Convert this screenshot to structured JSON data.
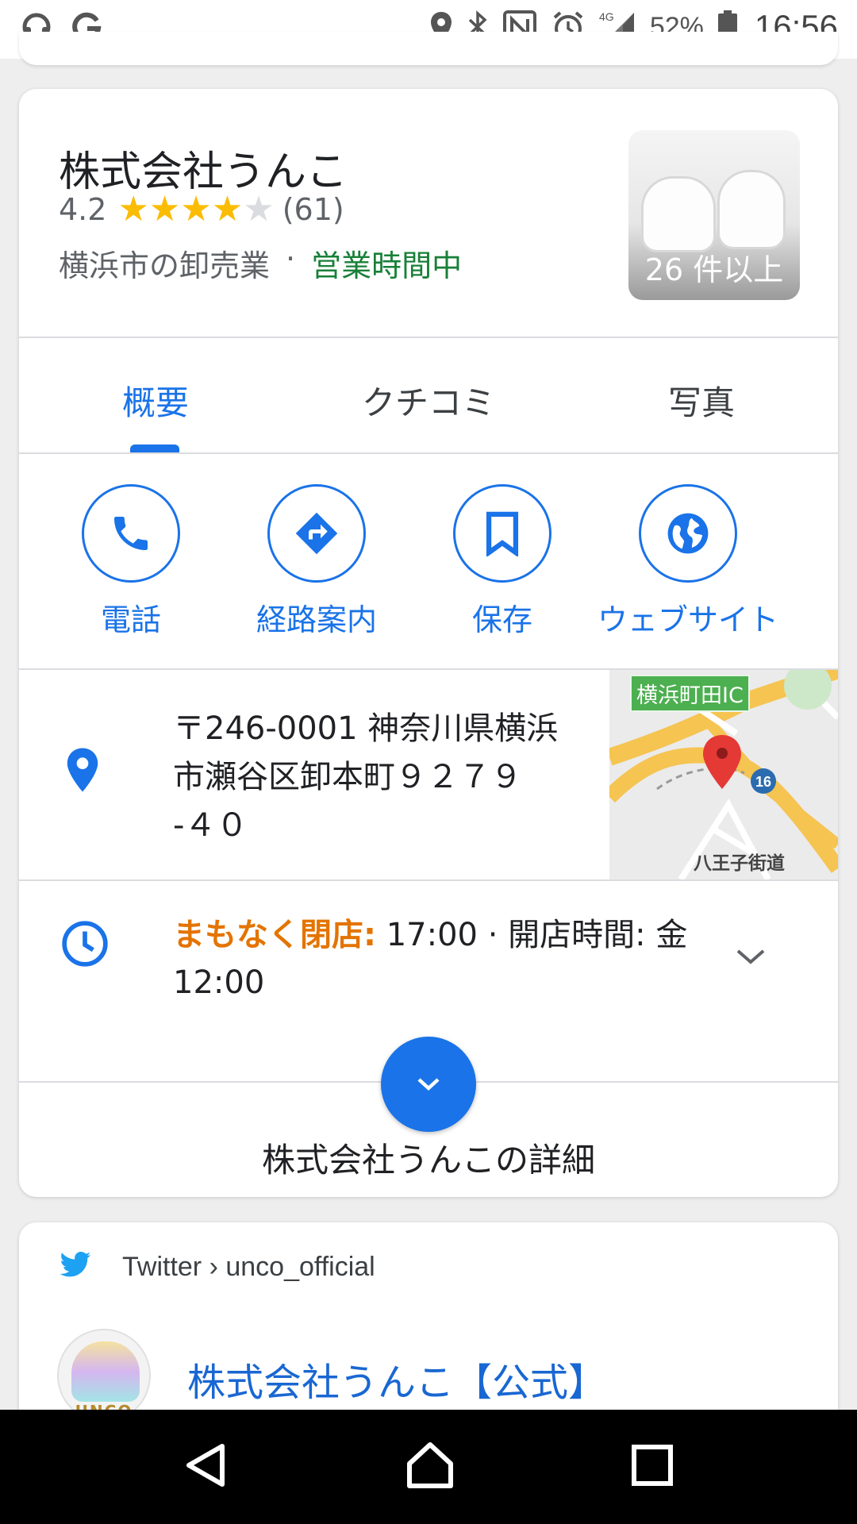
{
  "status_bar": {
    "battery_percent": "52%",
    "time": "16:56",
    "network": "4G"
  },
  "business": {
    "name": "株式会社うんこ",
    "rating": "4.2",
    "stars_filled": 4,
    "stars_total": 5,
    "review_count": "(61)",
    "category": "横浜市の卸売業",
    "separator": "·",
    "open_status": "営業時間中",
    "photo_count": "26 件以上"
  },
  "tabs": [
    {
      "label": "概要",
      "active": true
    },
    {
      "label": "クチコミ",
      "active": false
    },
    {
      "label": "写真",
      "active": false
    }
  ],
  "actions": [
    {
      "label": "電話",
      "icon": "phone-icon"
    },
    {
      "label": "経路案内",
      "icon": "directions-icon"
    },
    {
      "label": "保存",
      "icon": "bookmark-icon"
    },
    {
      "label": "ウェブサイト",
      "icon": "globe-icon"
    }
  ],
  "address": {
    "line1": "〒246-0001 神奈川県横浜",
    "line2": "市瀬谷区卸本町９２７９",
    "line3": "-４０",
    "map_label_ic": "横浜町田IC",
    "map_route": "16",
    "map_label_road": "八王子街道"
  },
  "hours": {
    "status": "まもなく閉店:",
    "detail_line1": " 17:00 · 開店時間: 金",
    "detail_line2": "12:00"
  },
  "details_label": "株式会社うんこの詳細",
  "twitter": {
    "breadcrumb": "Twitter › unco_official",
    "title": "株式会社うんこ【公式】",
    "avatar_text": "UNCO"
  },
  "colors": {
    "accent": "#1a73e8",
    "open_green": "#188038",
    "closing_orange": "#e37400",
    "star": "#fbbc04"
  }
}
